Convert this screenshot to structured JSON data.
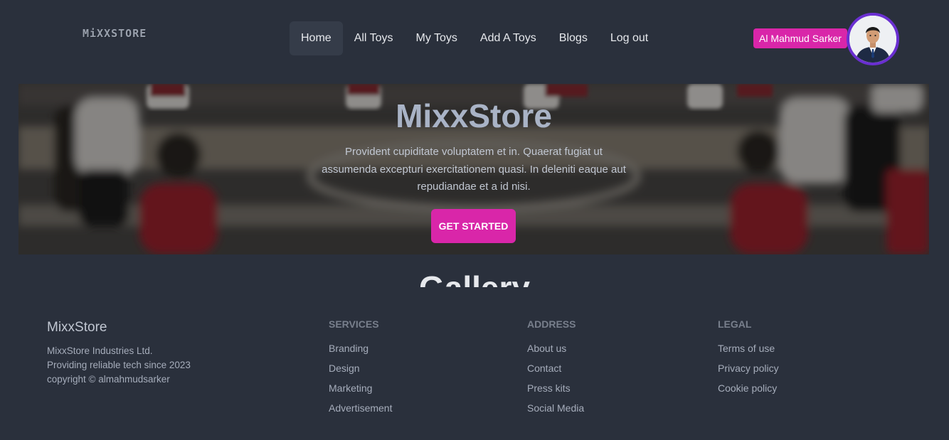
{
  "navbar": {
    "logo": "MiXXSTORE",
    "menu": [
      "Home",
      "All Toys",
      "My Toys",
      "Add A Toys",
      "Blogs",
      "Log out"
    ],
    "user_name": "Al Mahmud Sarker"
  },
  "hero": {
    "title": "MixxStore",
    "text": "Provident cupiditate voluptatem et in. Quaerat fugiat ut assumenda excepturi exercitationem quasi. In deleniti eaque aut repudiandae et a id nisi.",
    "button": "GET STARTED"
  },
  "gallery": {
    "heading": "Gallery"
  },
  "footer": {
    "brand": "MixxStore",
    "desc": [
      "MixxStore Industries Ltd.",
      "Providing reliable tech since 2023",
      "copyright © almahmudsarker"
    ],
    "columns": [
      {
        "title": "SERVICES",
        "links": [
          "Branding",
          "Design",
          "Marketing",
          "Advertisement"
        ]
      },
      {
        "title": "ADDRESS",
        "links": [
          "About us",
          "Contact",
          "Press kits",
          "Social Media"
        ]
      },
      {
        "title": "LEGAL",
        "links": [
          "Terms of use",
          "Privacy policy",
          "Cookie policy"
        ]
      }
    ]
  },
  "colors": {
    "background": "#2a303c",
    "accent": "#d926a9",
    "avatar_ring": "#6a2fd1"
  }
}
